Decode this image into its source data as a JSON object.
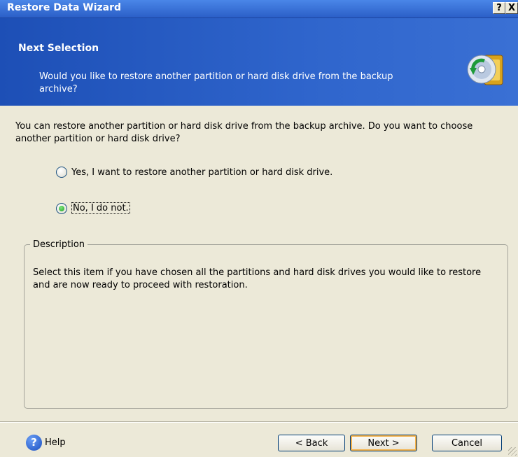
{
  "window": {
    "title": "Restore Data Wizard",
    "help_button": "?",
    "close_button": "X"
  },
  "header": {
    "title": "Next Selection",
    "subtitle": "Would you like to restore another partition or hard disk drive from the backup archive?",
    "icon": "restore-disk-icon"
  },
  "body": {
    "question": "You can restore another partition or hard disk drive from the backup archive. Do you want to choose another partition or hard disk drive?",
    "options": [
      {
        "label": "Yes, I want to restore another partition or hard disk drive.",
        "selected": false
      },
      {
        "label": "No, I do not.",
        "selected": true
      }
    ]
  },
  "description": {
    "legend": "Description",
    "text": "Select this item if you have chosen all the partitions and hard disk drives you would like to restore and are now ready to proceed with restoration."
  },
  "footer": {
    "help_label": "Help",
    "back_label": "< Back",
    "next_label": "Next >",
    "cancel_label": "Cancel"
  }
}
